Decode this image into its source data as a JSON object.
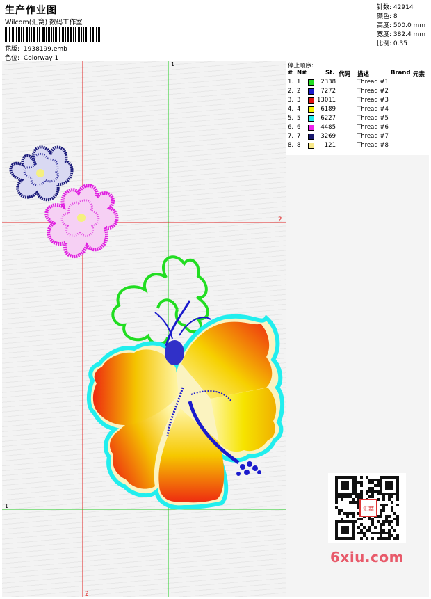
{
  "header": {
    "title": "生产作业图",
    "studio": "Wilcom(汇窝) 数码工作室",
    "design_label": "花版:",
    "design_file": "1938199.emb",
    "color_label": "色位:",
    "colorway": "Colorway 1"
  },
  "stats": [
    {
      "label": "针数:",
      "value": "42914"
    },
    {
      "label": "颜色:",
      "value": "8"
    },
    {
      "label": "高度:",
      "value": "500.0 mm"
    },
    {
      "label": "宽度:",
      "value": "382.4 mm"
    },
    {
      "label": "比例:",
      "value": "0.35"
    }
  ],
  "stop_sequence": {
    "title": "停止顺序:",
    "columns": {
      "num": "#",
      "no": "N#",
      "st": "St.",
      "code": "代码",
      "desc": "描述",
      "brand": "Brand",
      "element": "元素"
    },
    "rows": [
      {
        "num": "1.",
        "no": "1",
        "color": "#22dd22",
        "st": "2338",
        "desc": "Thread #1"
      },
      {
        "num": "2.",
        "no": "2",
        "color": "#1a1acc",
        "st": "7272",
        "desc": "Thread #2"
      },
      {
        "num": "3.",
        "no": "3",
        "color": "#e01010",
        "st": "13011",
        "desc": "Thread #3"
      },
      {
        "num": "4.",
        "no": "4",
        "color": "#f5f500",
        "st": "6189",
        "desc": "Thread #4"
      },
      {
        "num": "5.",
        "no": "5",
        "color": "#22eeee",
        "st": "6227",
        "desc": "Thread #5"
      },
      {
        "num": "6.",
        "no": "6",
        "color": "#ee22ee",
        "st": "4485",
        "desc": "Thread #6"
      },
      {
        "num": "7.",
        "no": "7",
        "color": "#16166e",
        "st": "3269",
        "desc": "Thread #7"
      },
      {
        "num": "8.",
        "no": "8",
        "color": "#f8e888",
        "st": "121",
        "desc": "Thread #8"
      }
    ]
  },
  "guides": {
    "v1": "1",
    "h2": "2",
    "h1": "1",
    "v2": "2"
  },
  "watermark": "6xiu.com",
  "stamp_text": "汇窝"
}
